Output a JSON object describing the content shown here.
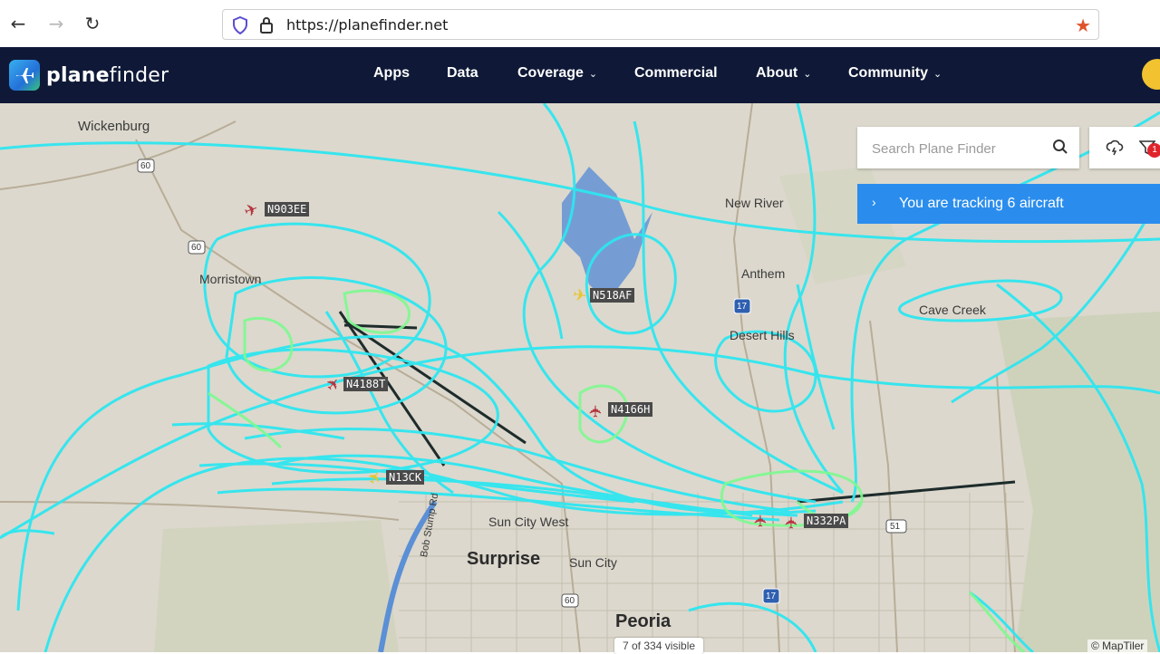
{
  "browser": {
    "url": "https://planefinder.net"
  },
  "header": {
    "logo_text_bold": "plane",
    "logo_text_light": "finder",
    "menu": [
      {
        "label": "Apps",
        "chevron": false
      },
      {
        "label": "Data",
        "chevron": false
      },
      {
        "label": "Coverage",
        "chevron": true
      },
      {
        "label": "Commercial",
        "chevron": false
      },
      {
        "label": "About",
        "chevron": true
      },
      {
        "label": "Community",
        "chevron": true
      }
    ]
  },
  "search": {
    "placeholder": "Search Plane Finder"
  },
  "tracking": {
    "text": "You are tracking 6 aircraft"
  },
  "notifications": {
    "badge": "1"
  },
  "map": {
    "places": [
      "Wickenburg",
      "Morristown",
      "New River",
      "Anthem",
      "Cave Creek",
      "Desert Hills",
      "Sun City West",
      "Sun City",
      "Surprise",
      "Peoria",
      "Bob Stump Rd"
    ],
    "highways": [
      "60",
      "60",
      "17",
      "51",
      "17",
      "60"
    ],
    "aircraft": [
      {
        "callsign": "N903EE",
        "color": "#b5333d"
      },
      {
        "callsign": "N518AF",
        "color": "#e8c431"
      },
      {
        "callsign": "N4188T",
        "color": "#b5333d"
      },
      {
        "callsign": "N4166H",
        "color": "#b5333d"
      },
      {
        "callsign": "N13CK",
        "color": "#e8c431"
      },
      {
        "callsign": "N332PA",
        "color": "#b5333d"
      }
    ],
    "visible_count": "7 of 334 visible",
    "attribution": "© MapTiler"
  },
  "colors": {
    "header_bg": "#0f1937",
    "track_cyan": "#2ee6f0",
    "track_green": "#7dfa8f",
    "banner_blue": "#2a8ded",
    "star_orange": "#e0532a"
  }
}
